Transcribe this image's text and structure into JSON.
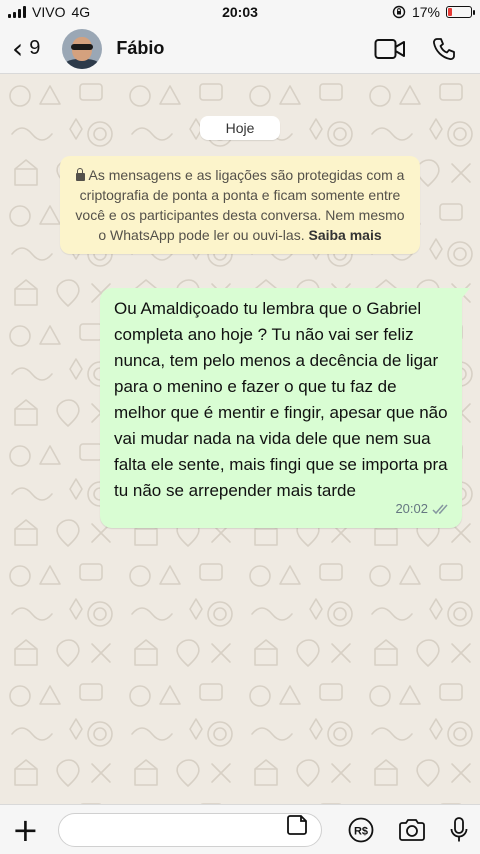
{
  "status_bar": {
    "carrier": "VIVO",
    "network": "4G",
    "time": "20:03",
    "battery_text": "17%",
    "battery_level": 0.17,
    "battery_color": "#e53935"
  },
  "header": {
    "back_count": "9",
    "contact_name": "Fábio",
    "icons": [
      "chevron-left-icon",
      "video-call-icon",
      "phone-call-icon"
    ]
  },
  "chat": {
    "date_label": "Hoje",
    "encryption_notice": "As mensagens e as ligações são protegidas com a criptografia de ponta a ponta e ficam somente entre você e os participantes desta conversa. Nem mesmo o WhatsApp pode ler ou ouvi-las.",
    "encryption_link": "Saiba mais",
    "messages": [
      {
        "direction": "outgoing",
        "text": "Ou Amaldiçoado tu lembra que o Gabriel completa ano hoje ? Tu não vai ser feliz nunca, tem pelo menos a decência de ligar para o menino e fazer o que tu faz de melhor que é mentir e fingir, apesar que não vai mudar nada na vida dele que nem sua falta ele sente, mais fingi que se importa pra tu não se arrepender mais tarde",
        "time": "20:02",
        "status": "read"
      }
    ],
    "bubble_color": "#d9fdd3",
    "notice_color": "#fcf4cb",
    "read_tick_color": "#8696a0"
  },
  "input_bar": {
    "placeholder": "",
    "icons": [
      "plus-icon",
      "sticker-icon",
      "pix-icon",
      "camera-icon",
      "microphone-icon"
    ],
    "pix_label": "R$"
  }
}
